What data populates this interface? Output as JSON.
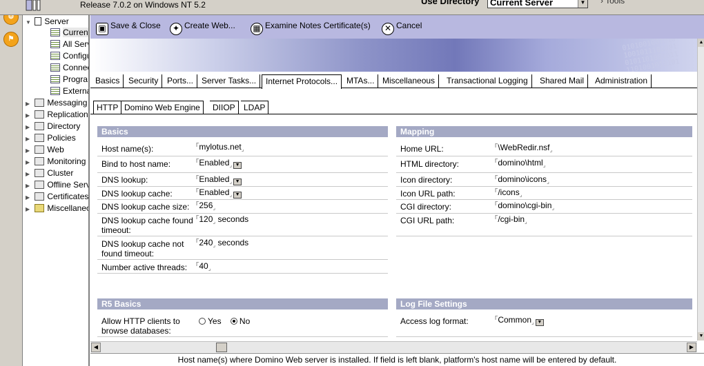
{
  "header": {
    "release": "Release 7.0.2 on Windows NT 5.2",
    "use_directory_label": "Use Directory",
    "use_directory_value": "Current Server",
    "tools_label": "Tools"
  },
  "tree": {
    "items": [
      {
        "label": "Server",
        "icon": "server-icon"
      },
      {
        "label": "Current",
        "icon": "document-icon"
      },
      {
        "label": "All Serv",
        "icon": "view-icon"
      },
      {
        "label": "Configu",
        "icon": "view-icon"
      },
      {
        "label": "Connec",
        "icon": "view-icon"
      },
      {
        "label": "Progra",
        "icon": "view-icon"
      },
      {
        "label": "Externa",
        "icon": "view-icon"
      },
      {
        "label": "Messaging",
        "icon": "messaging-icon"
      },
      {
        "label": "Replication",
        "icon": "replication-icon"
      },
      {
        "label": "Directory",
        "icon": "directory-icon"
      },
      {
        "label": "Policies",
        "icon": "policies-icon"
      },
      {
        "label": "Web",
        "icon": "web-icon"
      },
      {
        "label": "Monitoring",
        "icon": "monitoring-icon"
      },
      {
        "label": "Cluster",
        "icon": "cluster-icon"
      },
      {
        "label": "Offline Serv",
        "icon": "offline-icon"
      },
      {
        "label": "Certificates",
        "icon": "certificates-icon"
      },
      {
        "label": "Miscellaneo",
        "icon": "folder-icon"
      }
    ]
  },
  "actions": {
    "save_close": "Save & Close",
    "create_web": "Create Web...",
    "examine_cert": "Examine Notes Certificate(s)",
    "cancel": "Cancel"
  },
  "tabs_primary": [
    "Basics",
    "Security",
    "Ports...",
    "Server Tasks...",
    "Internet Protocols...",
    "MTAs...",
    "Miscellaneous",
    "Transactional Logging",
    "Shared Mail",
    "Administration"
  ],
  "tabs_secondary": [
    "HTTP",
    "Domino Web Engine",
    "DIIOP",
    "LDAP"
  ],
  "basics": {
    "title": "Basics",
    "host_names_label": "Host name(s):",
    "host_names_value": "mylotus.net",
    "bind_label": "Bind to host name:",
    "bind_value": "Enabled",
    "dns_lookup_label": "DNS lookup:",
    "dns_lookup_value": "Enabled",
    "dns_cache_label": "DNS lookup cache:",
    "dns_cache_value": "Enabled",
    "dns_cache_size_label": "DNS lookup cache size:",
    "dns_cache_size_value": "256",
    "found_timeout_label": "DNS lookup cache found timeout:",
    "found_timeout_value": "120",
    "not_found_timeout_label": "DNS lookup cache not found timeout:",
    "not_found_timeout_value": "240",
    "seconds_unit": "seconds",
    "threads_label": "Number active threads:",
    "threads_value": "40"
  },
  "mapping": {
    "title": "Mapping",
    "home_url_label": "Home URL:",
    "home_url_value": "\\WebRedir.nsf",
    "html_dir_label": "HTML directory:",
    "html_dir_value": "domino\\html",
    "icon_dir_label": "Icon directory:",
    "icon_dir_value": "domino\\icons",
    "icon_url_label": "Icon URL path:",
    "icon_url_value": "/icons",
    "cgi_dir_label": "CGI directory:",
    "cgi_dir_value": "domino\\cgi-bin",
    "cgi_url_label": "CGI URL path:",
    "cgi_url_value": "/cgi-bin"
  },
  "r5": {
    "title": "R5 Basics",
    "allow_browse_label": "Allow HTTP clients to browse databases:",
    "yes_label": "Yes",
    "no_label": "No",
    "selected": "No"
  },
  "logfile": {
    "title": "Log File Settings",
    "access_format_label": "Access log format:",
    "access_format_value": "Common"
  },
  "status": "Host name(s) where Domino Web server is  installed. If field is left blank, platform's host name will be entered by default."
}
